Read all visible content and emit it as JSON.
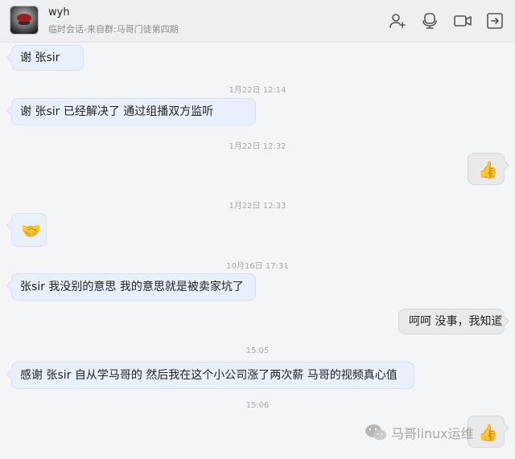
{
  "header": {
    "name": "wyh",
    "subtitle": "临时会话-来自群:马哥门徒第四期",
    "icons": [
      "add-member-icon",
      "video-call-icon",
      "screen-share-icon",
      "forward-icon"
    ]
  },
  "messages": [
    {
      "dir": "in",
      "text": "谢 张sir"
    },
    {
      "ts": "1月22日  12:14"
    },
    {
      "dir": "in",
      "text": "谢 张sir  已经解决了  通过组播双方监听"
    },
    {
      "ts": "1月22日  12:32"
    },
    {
      "dir": "out",
      "emoji": "👍",
      "icon": "thumbs-up-icon"
    },
    {
      "ts": "1月22日  12:33"
    },
    {
      "dir": "in",
      "emoji": "🤝",
      "icon": "handshake-icon"
    },
    {
      "ts": "10月16日  17:31"
    },
    {
      "dir": "in",
      "text": "张sir  我没别的意思 我的意思就是被卖家坑了"
    },
    {
      "dir": "out",
      "text": "呵呵 没事，我知道"
    },
    {
      "ts": "15:05"
    },
    {
      "dir": "in",
      "text": "感谢 张sir  自从学马哥的 然后我在这个小公司涨了两次薪  马哥的视频真心值"
    },
    {
      "ts": "15:06"
    },
    {
      "dir": "out",
      "emoji": "👍",
      "icon": "thumbs-up-icon"
    }
  ],
  "watermark": {
    "text": "马哥linux运维"
  }
}
